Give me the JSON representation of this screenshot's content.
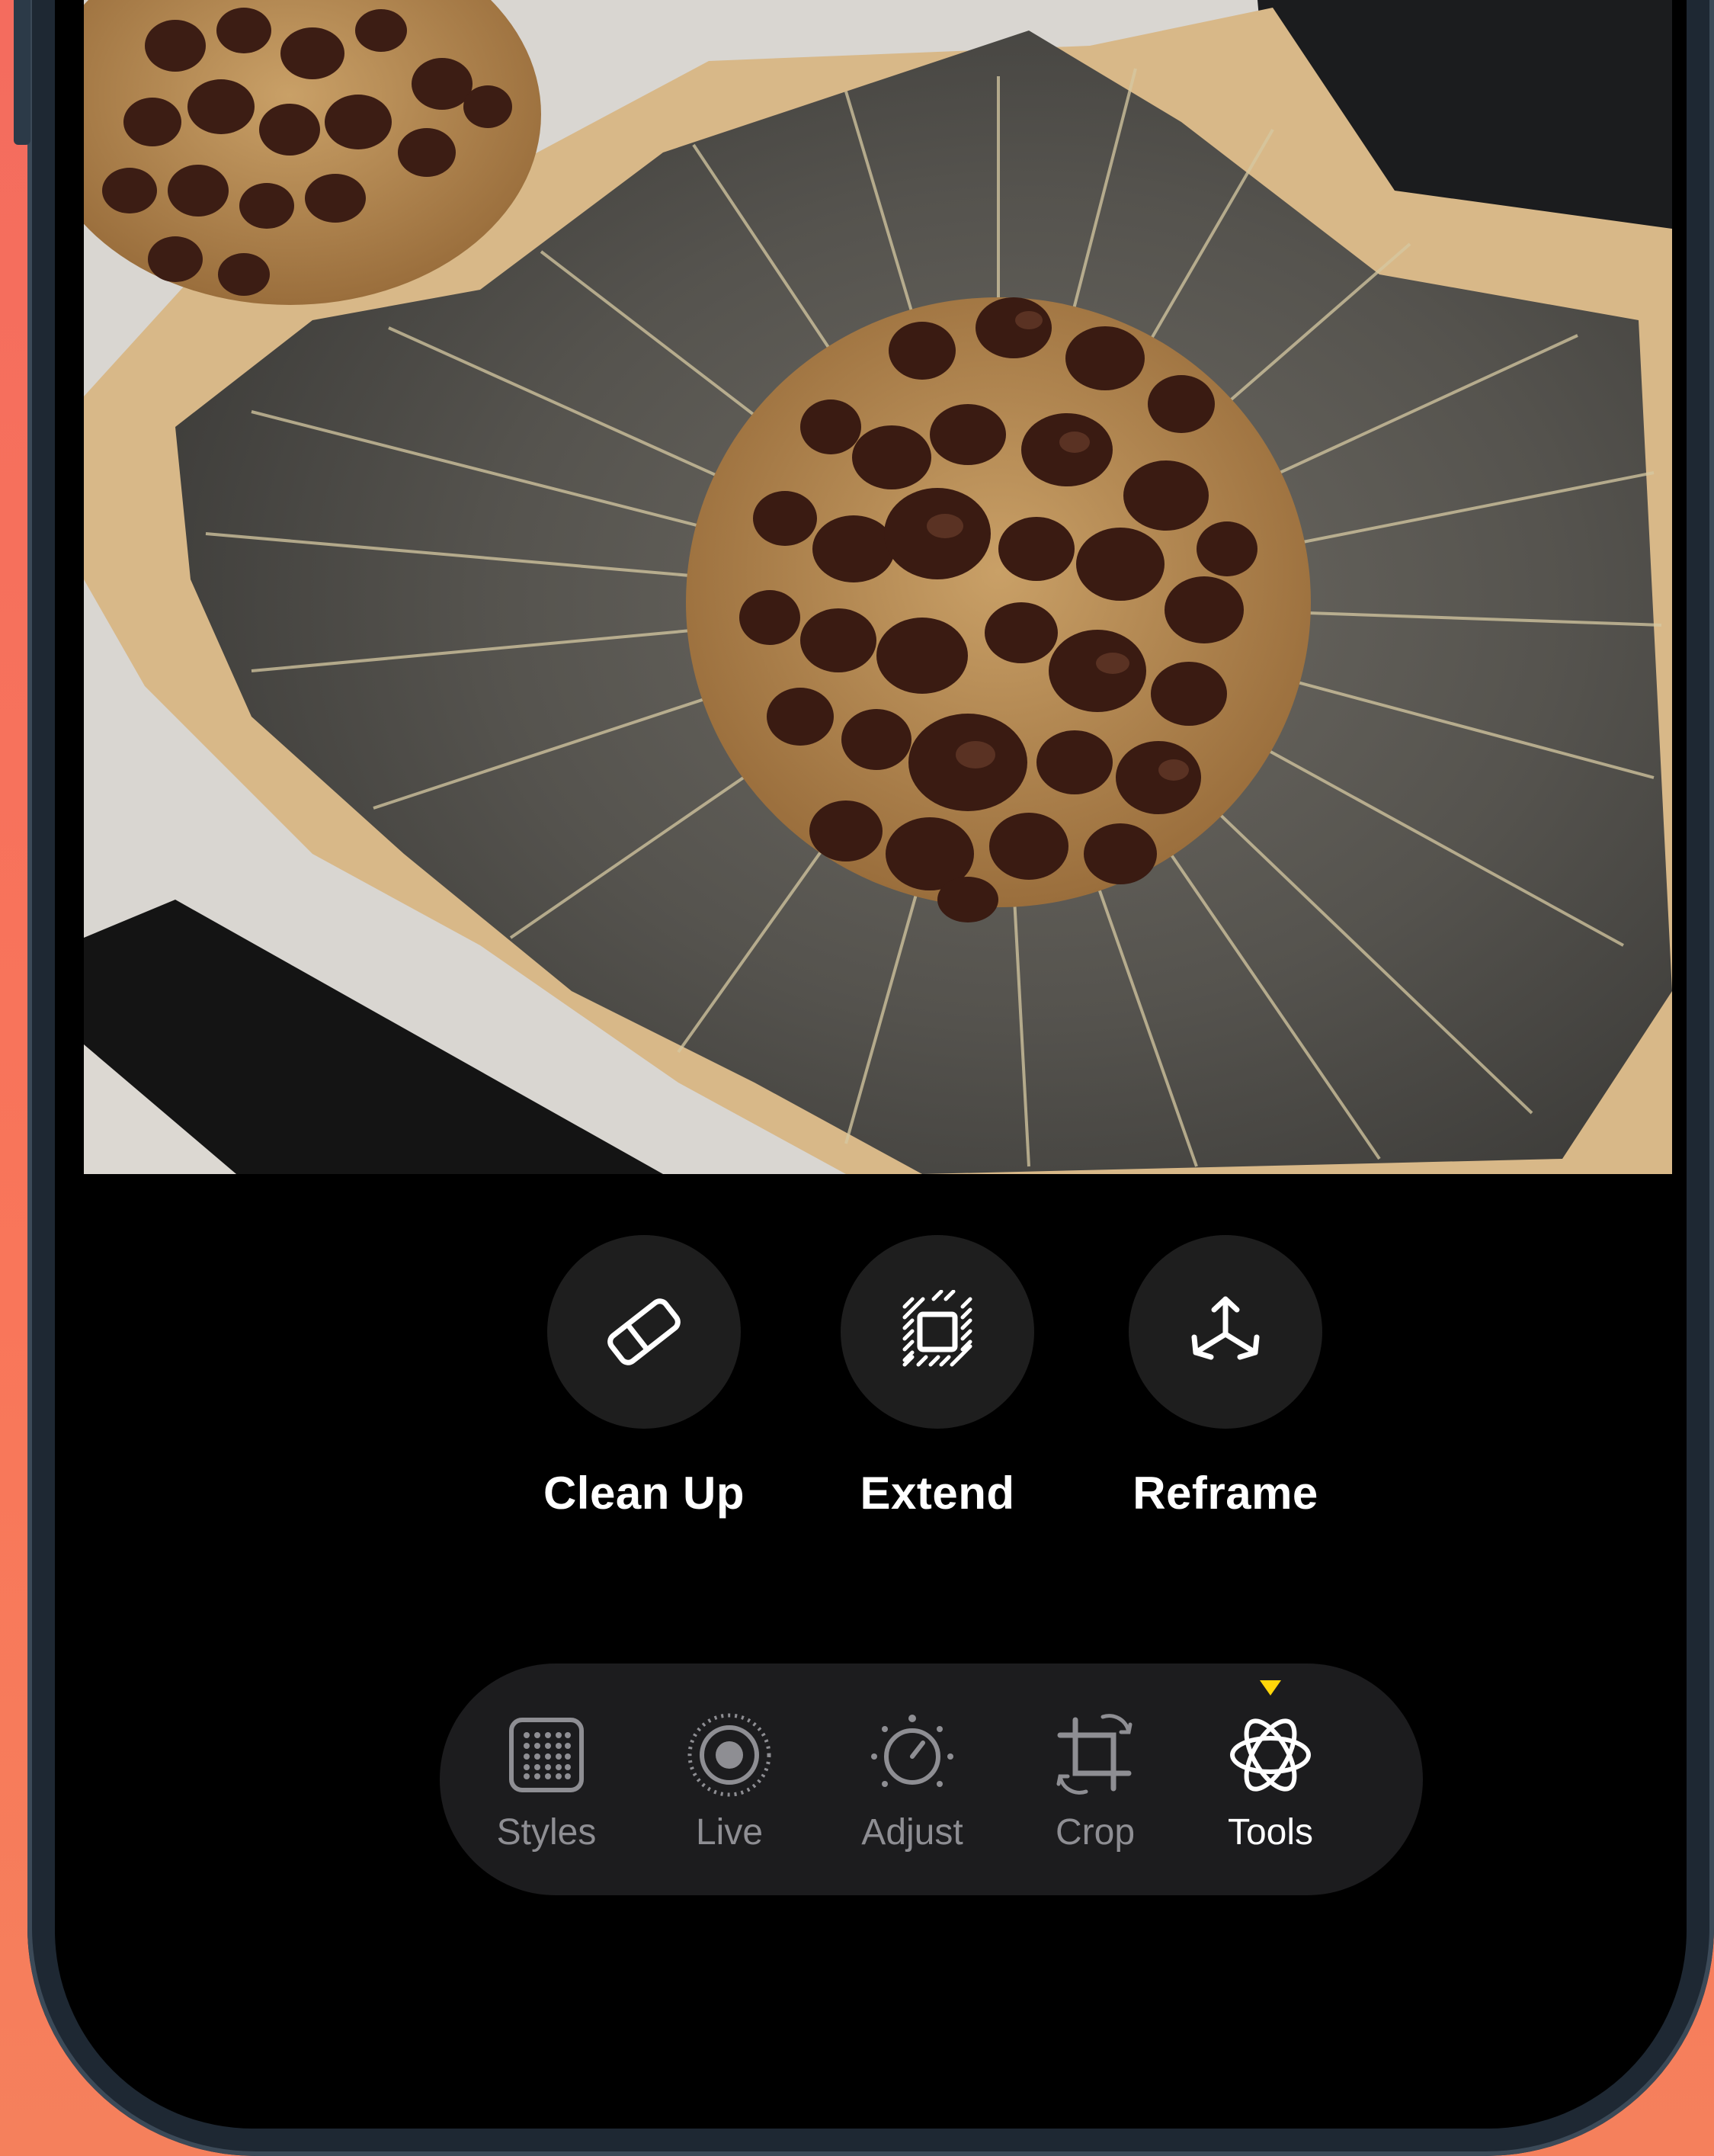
{
  "editor": {
    "actions": [
      {
        "label": "Clean Up",
        "icon": "eraser-icon"
      },
      {
        "label": "Extend",
        "icon": "extend-frame-icon"
      },
      {
        "label": "Reframe",
        "icon": "reframe-3d-icon"
      }
    ]
  },
  "tab_bar": {
    "tabs": [
      {
        "label": "Styles",
        "icon": "styles-grid-icon",
        "active": false
      },
      {
        "label": "Live",
        "icon": "live-photo-icon",
        "active": false
      },
      {
        "label": "Adjust",
        "icon": "adjust-dial-icon",
        "active": false
      },
      {
        "label": "Crop",
        "icon": "crop-rotate-icon",
        "active": false
      },
      {
        "label": "Tools",
        "icon": "tools-sparkle-icon",
        "active": true
      }
    ],
    "active_indicator_color": "#ffd60a"
  },
  "colors": {
    "background_gradient": "#f46c5e",
    "screen": "#000000",
    "button_fill": "#1e1e1e",
    "tab_bar_fill": "#1c1c1e",
    "inactive_label": "#8e8e93",
    "active_label": "#ffffff"
  }
}
